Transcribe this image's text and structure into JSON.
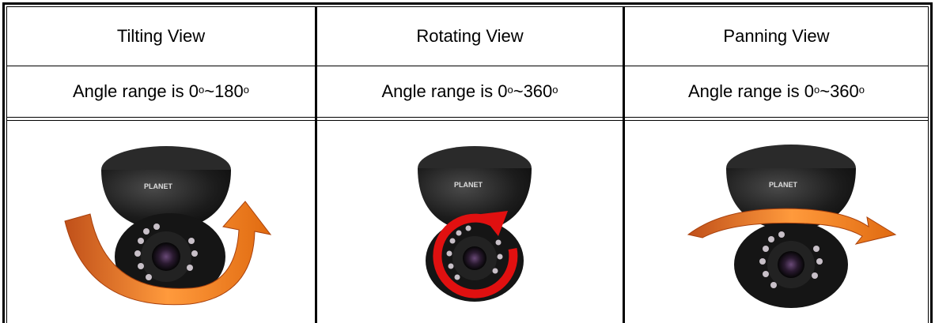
{
  "table": {
    "headers": [
      "Tilting View",
      "Rotating View",
      "Panning View"
    ],
    "angle_rows": [
      {
        "prefix": "Angle range is 0",
        "mid": "~180"
      },
      {
        "prefix": "Angle range is 0",
        "mid": "~360"
      },
      {
        "prefix": "Angle range is 0",
        "mid": "~360"
      }
    ],
    "degree_mark": "o",
    "brand": "PLANET"
  },
  "colors": {
    "camera_body": "#1c1c1c",
    "arrow_orange": "#e8701a",
    "arrow_red": "#e01010"
  }
}
